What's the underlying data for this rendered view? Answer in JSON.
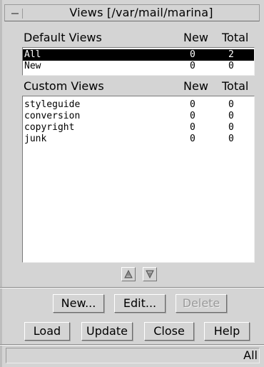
{
  "window": {
    "title": "Views [/var/mail/marina]"
  },
  "default_views": {
    "header": {
      "name": "Default Views",
      "new": "New",
      "total": "Total"
    },
    "rows": [
      {
        "name": "All",
        "new": "0",
        "total": "2",
        "selected": true
      },
      {
        "name": "New",
        "new": "0",
        "total": "0",
        "selected": false
      }
    ]
  },
  "custom_views": {
    "header": {
      "name": "Custom Views",
      "new": "New",
      "total": "Total"
    },
    "rows": [
      {
        "name": "styleguide",
        "new": "0",
        "total": "0"
      },
      {
        "name": "conversion",
        "new": "0",
        "total": "0"
      },
      {
        "name": "copyright",
        "new": "0",
        "total": "0"
      },
      {
        "name": "junk",
        "new": "0",
        "total": "0"
      }
    ]
  },
  "buttons_row1": {
    "new": "New...",
    "edit": "Edit...",
    "delete": "Delete"
  },
  "buttons_row2": {
    "load": "Load",
    "update": "Update",
    "close": "Close",
    "help": "Help"
  },
  "status": {
    "text": "All"
  },
  "icons": {
    "move_up": "move-up-arrow-icon",
    "move_down": "move-down-arrow-icon",
    "window_menu": "window-menu-icon"
  },
  "colors": {
    "background": "#d4d4d4",
    "list_background": "#ffffff",
    "selection": "#000000",
    "disabled_text": "#9a9a9a"
  }
}
